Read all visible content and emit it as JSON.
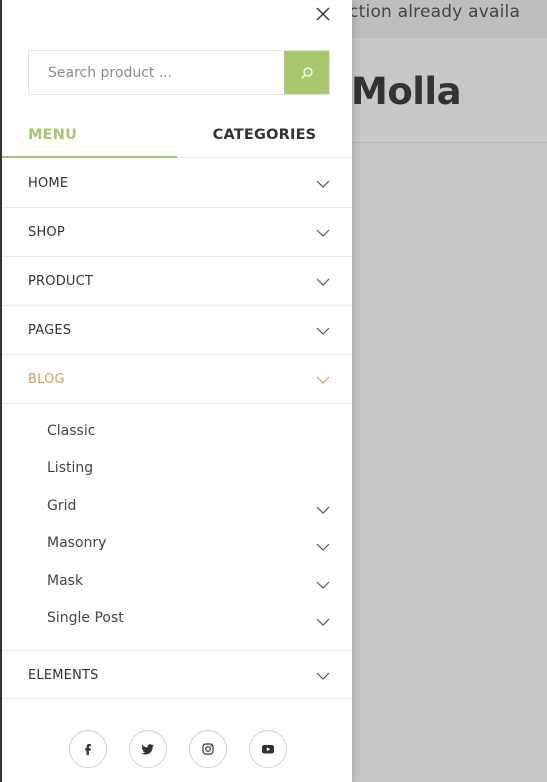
{
  "background": {
    "topbar_text": "ollection already availa",
    "logo": "Molla"
  },
  "drawer": {
    "close_icon": "close-icon",
    "search": {
      "placeholder": "Search product ...",
      "button_icon": "search-icon"
    },
    "tabs": [
      {
        "label": "MENU",
        "active": true
      },
      {
        "label": "CATEGORIES",
        "active": false
      }
    ],
    "menu": [
      {
        "label": "HOME",
        "has_children": true
      },
      {
        "label": "SHOP",
        "has_children": true
      },
      {
        "label": "PRODUCT",
        "has_children": true
      },
      {
        "label": "PAGES",
        "has_children": true
      },
      {
        "label": "BLOG",
        "has_children": true,
        "expanded": true
      },
      {
        "label": "ELEMENTS",
        "has_children": true
      }
    ],
    "blog_submenu": [
      {
        "label": "Classic",
        "has_children": false
      },
      {
        "label": "Listing",
        "has_children": false
      },
      {
        "label": "Grid",
        "has_children": true
      },
      {
        "label": "Masonry",
        "has_children": true
      },
      {
        "label": "Mask",
        "has_children": true
      },
      {
        "label": "Single Post",
        "has_children": true
      }
    ],
    "social": [
      "facebook-icon",
      "twitter-icon",
      "instagram-icon",
      "youtube-icon"
    ]
  },
  "colors": {
    "accent": "#a6c76c",
    "active_item": "#c9a25c",
    "overlay": "#c7c7c7"
  }
}
